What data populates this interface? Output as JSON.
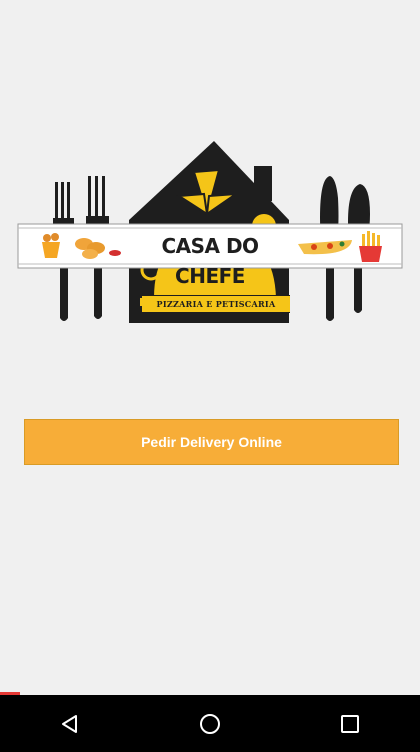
{
  "logo": {
    "title": "CASA DO CHEFE",
    "subtitle": "PIZZARIA E PETISCARIA"
  },
  "cta": {
    "label": "Pedir Delivery Online"
  },
  "navbar": {
    "back_icon": "back-triangle-icon",
    "home_icon": "home-circle-icon",
    "recents_icon": "recents-square-icon"
  },
  "colors": {
    "background": "#f0f0f0",
    "button": "#f7ad38",
    "logo_yellow": "#f5c518",
    "logo_dark": "#1e1e1e",
    "navbar": "#000000"
  }
}
